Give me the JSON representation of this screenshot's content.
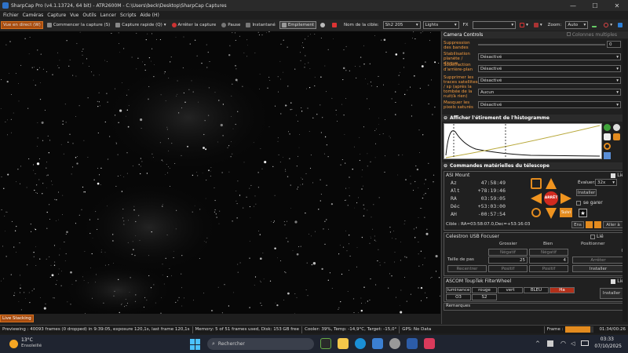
{
  "window": {
    "title": "SharpCap Pro (v4.1.13724, 64 bit) - ATR2600M - C:\\Users\\beck\\Desktop\\SharpCap Captures"
  },
  "menu": [
    "Fichier",
    "Caméras",
    "Capture",
    "Vue",
    "Outils",
    "Lancer",
    "Scripts",
    "Aide (H)"
  ],
  "toolbar": {
    "live_view": "Vue en direct (W)",
    "start_capture": "Commencer la capture (S)",
    "quick_capture": "Capture rapide (Q)",
    "stop_capture": "Arrêter la capture",
    "pause": "Pause",
    "snapshot": "Instantané",
    "stacking": "Empilement",
    "target_label": "Nom de la cible:",
    "target_value": "Sh2 205",
    "frame_type": "Lights",
    "fx_label": "FX",
    "zoom_label": "Zoom:",
    "zoom_value": "Auto"
  },
  "camera_controls": {
    "title": "Camera Controls",
    "multi_columns": "Colonnes multiples",
    "rows": [
      {
        "label": "Suppression des bandes",
        "value": "0"
      },
      {
        "label": "Stabilisation planète / disque",
        "value": "Désactivé"
      },
      {
        "label": "Soustraction d'arrière-plan",
        "value": "Désactivé"
      },
      {
        "label": "Supprimer les traces satellites / sp (après la tombée de la nuit/à rien)",
        "value": "Désactivé"
      },
      {
        "label": "",
        "value": "Aucun"
      },
      {
        "label": "Masquer les pixels saturés",
        "value": "Désactivé"
      }
    ]
  },
  "histogram": {
    "title": "Afficher l'étirement de l'histogramme"
  },
  "telescope": {
    "title": "Commandes matérielles du télescope",
    "linked_label": "Lié",
    "mount_name": "ASI Mount",
    "coords": [
      {
        "label": "Az",
        "value": "47:58:49"
      },
      {
        "label": "Alt",
        "value": "+78:19:46"
      },
      {
        "label": "RA",
        "value": "03:59:05"
      },
      {
        "label": "Déc",
        "value": "+53:03:00"
      },
      {
        "label": "AH",
        "value": "-00:57:54"
      }
    ],
    "stop_label": "ARRÊT",
    "slow_label": "Suivi",
    "rate_label": "Évaluer:",
    "rate_value": "32x",
    "install_btn": "Installer",
    "park_label": "se garer",
    "target_line": "Cible : RA=03:58:07.0,Dec=+53:16:03",
    "ens_btn": "Ens",
    "goto_btn": "Aller à"
  },
  "focuser": {
    "title": "Celestron USB Focuser",
    "linked_label": "Lié",
    "col_coarse": "Grossier",
    "col_fine": "Bien",
    "col_position": "Positionner",
    "neg": "Négatif",
    "neg2": "Négatif",
    "position_value": "0",
    "step_label": "Taille de pas",
    "coarse_step": "25",
    "fine_step": "4",
    "stop_btn": "Arrêter",
    "back_btn": "Recentrer",
    "pos": "Positif",
    "pos2": "Positif",
    "install_btn": "Installer"
  },
  "filterwheel": {
    "title": "ASCOM ToupTek FilterWheel",
    "linked_label": "Lié",
    "filters_row1": [
      "luminance",
      "rouge",
      "vert",
      "BLEU",
      "Ha"
    ],
    "filters_row2": [
      "O3",
      "S2"
    ],
    "active_filter": "Ha",
    "install_btn": "Installer"
  },
  "remarks_label": "Remarques",
  "live_stacking_btn": "Live Stacking",
  "status": {
    "preview": "Previewing : 40093 frames (0 dropped) in 9:39:05, exposure 120,1s, last frame 120,1s",
    "memory": "Memory: 5 of 51 frames used, Disk: 153 GB free",
    "cooler": "Cooler: 39%, Temp: -14,9°C, Target: -15,0°",
    "gps": "GPS: No Data",
    "frame_label": "Frame :",
    "frame_time": "01:34/00:26",
    "frame_progress": 0.88
  },
  "taskbar": {
    "weather_temp": "13°C",
    "weather_text": "Ensoleillé",
    "search_placeholder": "Rechercher",
    "time": "03:33",
    "date": "07/10/2025"
  },
  "colors": {
    "accent": "#d6701e",
    "active_filter": "#b2301a",
    "highlight_text": "#f29a3f"
  }
}
